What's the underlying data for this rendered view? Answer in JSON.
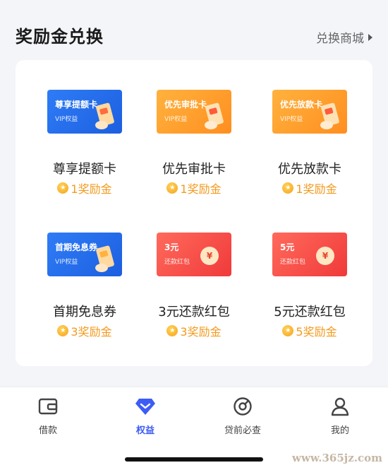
{
  "header": {
    "title": "奖励金兑换",
    "shop_link": "兑换商城"
  },
  "items": [
    {
      "tile_title": "尊享提额卡",
      "tile_sub": "VIP权益",
      "name": "尊享提额卡",
      "price": "1奖励金",
      "color": "blue",
      "icon": "phone-card-icon"
    },
    {
      "tile_title": "优先审批卡",
      "tile_sub": "VIP权益",
      "name": "优先审批卡",
      "price": "1奖励金",
      "color": "orange",
      "icon": "phone-card-icon"
    },
    {
      "tile_title": "优先放款卡",
      "tile_sub": "VIP权益",
      "name": "优先放款卡",
      "price": "1奖励金",
      "color": "orange",
      "icon": "phone-card-icon"
    },
    {
      "tile_title": "首期免息券",
      "tile_sub": "VIP权益",
      "name": "首期免息券",
      "price": "3奖励金",
      "color": "blue",
      "icon": "phone-card-icon"
    },
    {
      "tile_title": "3元",
      "tile_sub": "还款红包",
      "name": "3元还款红包",
      "price": "3奖励金",
      "color": "red",
      "icon": "yen-icon"
    },
    {
      "tile_title": "5元",
      "tile_sub": "还款红包",
      "name": "5元还款红包",
      "price": "5奖励金",
      "color": "red",
      "icon": "yen-icon"
    }
  ],
  "tabbar": {
    "tabs": [
      {
        "label": "借款",
        "icon": "wallet-icon",
        "active": false
      },
      {
        "label": "权益",
        "icon": "diamond-icon",
        "active": true
      },
      {
        "label": "贷前必查",
        "icon": "gauge-icon",
        "active": false
      },
      {
        "label": "我的",
        "icon": "person-icon",
        "active": false
      }
    ]
  },
  "colors": {
    "accent": "#3d5cf5",
    "coin": "#f39a1e",
    "tile_blue": "#2f7cf6",
    "tile_orange": "#ff9f2a",
    "tile_red": "#f04a45"
  },
  "watermark": "www.365jz.com"
}
